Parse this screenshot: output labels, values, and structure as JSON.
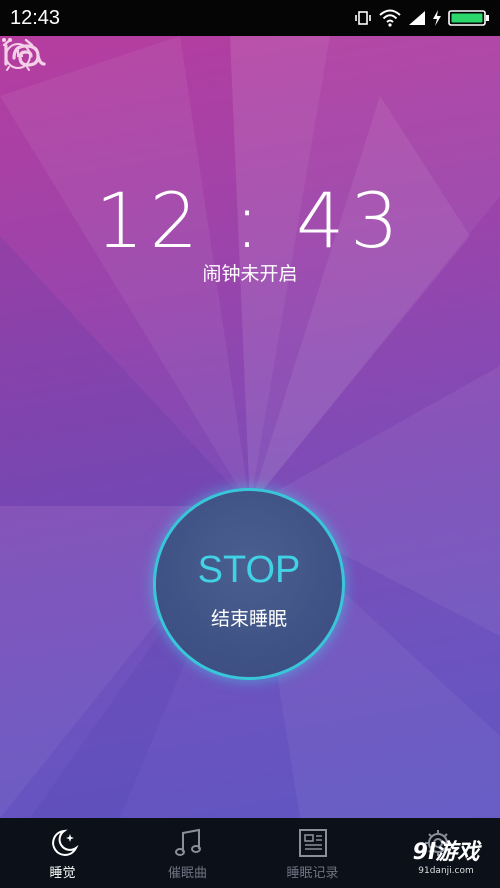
{
  "status_bar": {
    "time": "12:43"
  },
  "clock": {
    "time": "12 : 43",
    "alarm_status": "闹钟未开启"
  },
  "stop_button": {
    "label": "STOP",
    "sublabel": "结束睡眠"
  },
  "tabs": [
    {
      "label": "睡觉",
      "icon": "moon-star-icon",
      "active": true
    },
    {
      "label": "催眠曲",
      "icon": "music-note-icon",
      "active": false
    },
    {
      "label": "睡眠记录",
      "icon": "record-list-icon",
      "active": false
    },
    {
      "label": "",
      "icon": "gear-icon",
      "active": false
    }
  ],
  "watermark": {
    "main": "9l游戏",
    "sub": "91danji.com"
  },
  "colors": {
    "accent": "#41d2e6",
    "bar": "#0c1119",
    "ring": "#38c7d9"
  }
}
